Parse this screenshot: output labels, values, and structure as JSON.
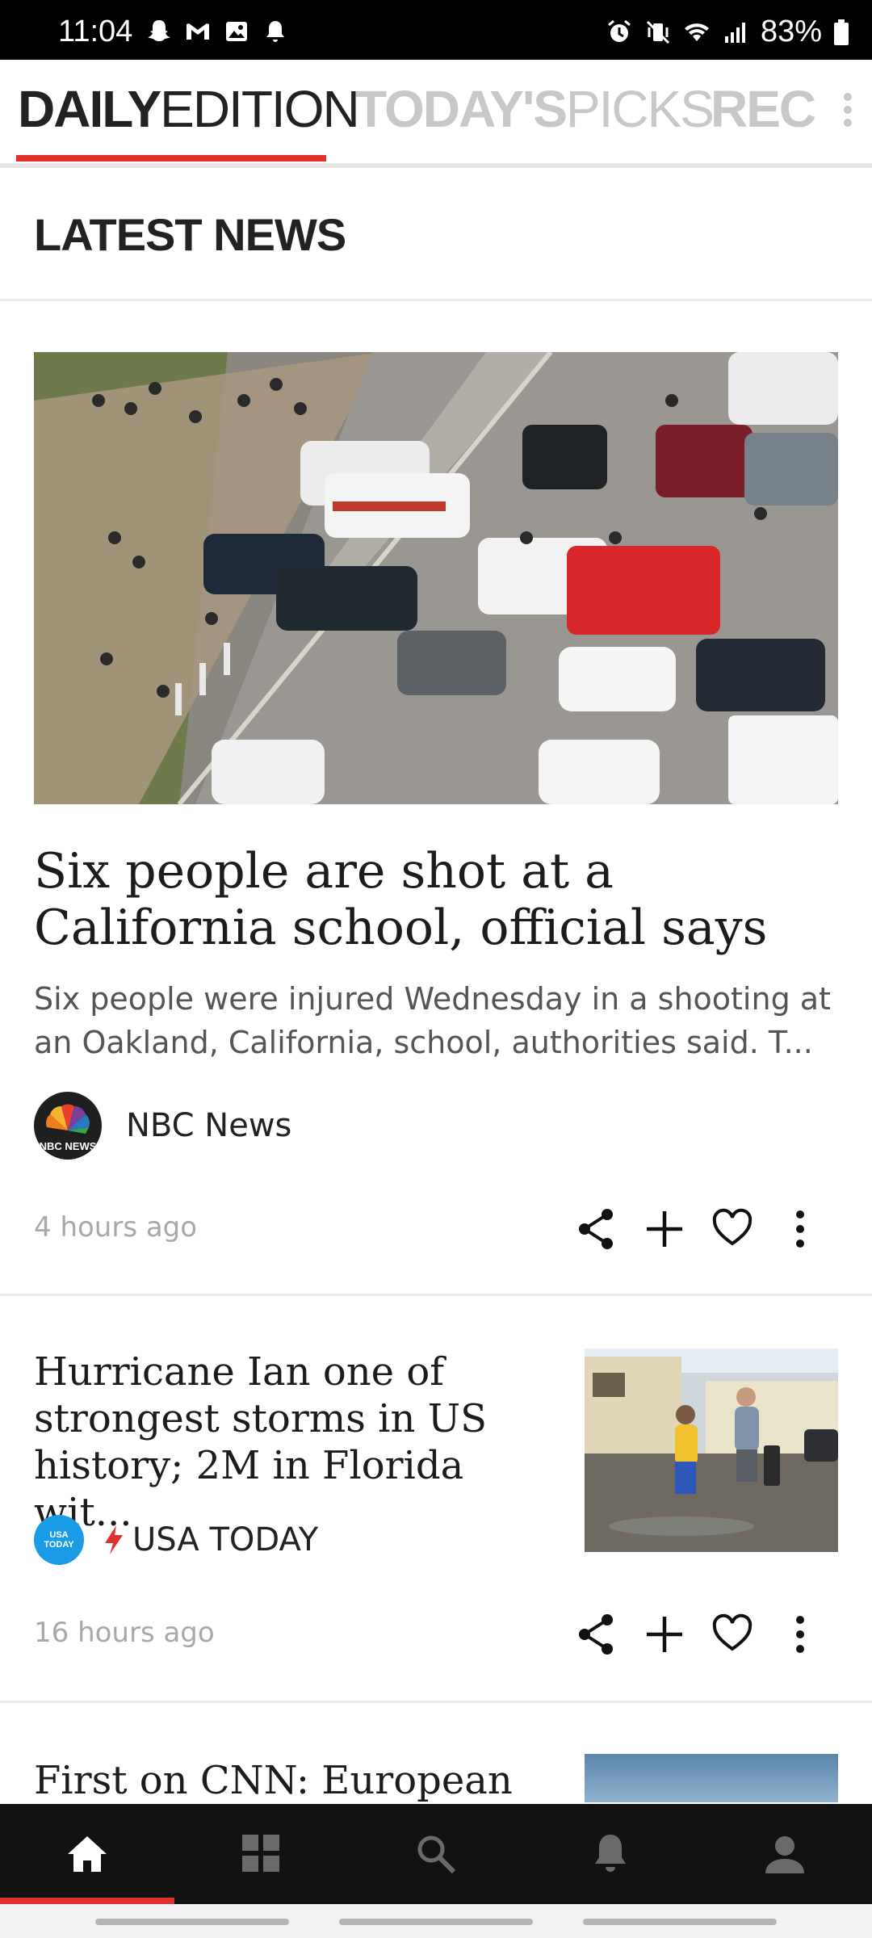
{
  "status_bar": {
    "time": "11:04",
    "battery": "83%",
    "left_icons": [
      "snapchat-icon",
      "gmail-icon",
      "gallery-icon",
      "notification-bell-icon"
    ],
    "right_icons": [
      "alarm-icon",
      "vibrate-mute-icon",
      "wifi-icon",
      "signal-icon",
      "battery-icon"
    ]
  },
  "tabs": [
    {
      "bold": "DAILY",
      "light": "EDITION",
      "active": true
    },
    {
      "bold": "TODAY'S",
      "light": "PICKS",
      "active": false
    },
    {
      "bold": "RECI",
      "light": "",
      "active": false
    }
  ],
  "section": {
    "title": "LATEST NEWS"
  },
  "articles": [
    {
      "title": "Six people are shot at a California school, official says",
      "summary": "Six people were injured Wednesday in a shooting at an Oakland, California, school, authorities said. T...",
      "source": "NBC News",
      "source_logo_text": "NBC NEWS",
      "time": "4 hours ago"
    },
    {
      "title": "Hurricane Ian one of strongest storms in US history; 2M in Florida wit...",
      "source": "USA TODAY",
      "source_logo_text": "USA TODAY",
      "time": "16 hours ago"
    },
    {
      "title": "First on CNN: European"
    }
  ],
  "bottom_nav": [
    "home-icon",
    "grid-icon",
    "search-icon",
    "notifications-icon",
    "profile-icon"
  ],
  "colors": {
    "accent": "#e0312f",
    "nav_bg": "#121212",
    "usa_today_blue": "#1a9be6"
  }
}
